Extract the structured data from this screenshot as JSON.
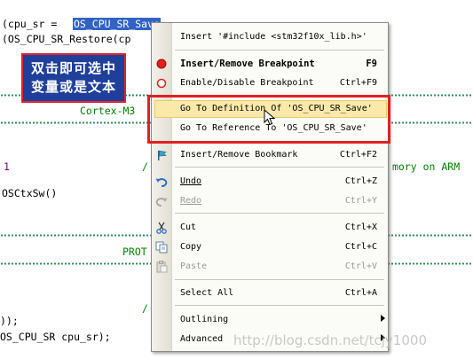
{
  "editor": {
    "lines": {
      "l1_pre": "(cpu_sr = ",
      "l1_sel": "OS_CPU_SR_Save",
      "l1_post": "();",
      "l2": "(OS_CPU_SR_Restore(cp",
      "l3": "Cortex-M3",
      "l4_num": "1",
      "l4_slash": "/",
      "l4_right": "mory on ARM",
      "l5": "OSCtxSw()",
      "l6": "PROT",
      "l7_slash": "/",
      "l8": "));",
      "l9": "OS_CPU_SR cpu_sr);"
    }
  },
  "callout": {
    "line1": "双击即可选中",
    "line2": "变量或是文本"
  },
  "context_menu": {
    "items": [
      {
        "label": "Insert '#include <stm32f10x_lib.h>'",
        "shortcut": ""
      },
      {
        "label": "Insert/Remove Breakpoint",
        "shortcut": "F9"
      },
      {
        "label": "Enable/Disable Breakpoint",
        "shortcut": "Ctrl+F9"
      },
      {
        "label": "Go To Definition Of 'OS_CPU_SR_Save'",
        "shortcut": ""
      },
      {
        "label": "Go To Reference To 'OS_CPU_SR_Save'",
        "shortcut": ""
      },
      {
        "label": "Insert/Remove Bookmark",
        "shortcut": "Ctrl+F2"
      },
      {
        "label": "Undo",
        "shortcut": "Ctrl+Z"
      },
      {
        "label": "Redo",
        "shortcut": "Ctrl+Y"
      },
      {
        "label": "Cut",
        "shortcut": "Ctrl+X"
      },
      {
        "label": "Copy",
        "shortcut": "Ctrl+C"
      },
      {
        "label": "Paste",
        "shortcut": "Ctrl+V"
      },
      {
        "label": "Select All",
        "shortcut": "Ctrl+A"
      },
      {
        "label": "Outlining",
        "shortcut": ""
      },
      {
        "label": "Advanced",
        "shortcut": ""
      }
    ]
  },
  "icons": {
    "breakpoint": "red-dot-icon",
    "enable_breakpoint": "hollow-red-circle-icon",
    "bookmark": "flag-icon",
    "undo": "undo-arrow-icon",
    "redo": "redo-arrow-icon",
    "cut": "scissors-icon",
    "copy": "copy-icon",
    "paste": "paste-icon",
    "cursor": "mouse-pointer-icon"
  },
  "colors": {
    "selection": "#3163c5",
    "highlight": "#fbe9a9",
    "annotation_red": "#e02020",
    "callout_bg": "#1f3f9b"
  },
  "watermark": "http://blog.csdn.net/tcjy1000"
}
